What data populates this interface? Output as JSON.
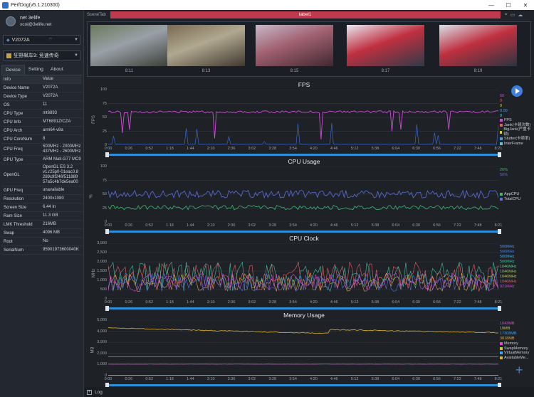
{
  "window": {
    "title": "PerfDog(v5.1.210300)"
  },
  "user": {
    "name": "net 3elife",
    "email": "xcoi@3elife.net"
  },
  "device_select": {
    "value": "V2072A"
  },
  "app_select": {
    "value": "狂野飙车9: 竞速传奇"
  },
  "tabs": [
    "Device",
    "Setting",
    "About"
  ],
  "device_table": {
    "headers": [
      "Info",
      "Value"
    ],
    "rows": [
      [
        "Device Name",
        "V2072A"
      ],
      [
        "Device Type",
        "V2072A"
      ],
      [
        "OS",
        "11"
      ],
      [
        "CPU Type",
        "mt6893"
      ],
      [
        "CPU Info",
        "MT6891Z/CZA"
      ],
      [
        "CPU Arch",
        "arm64-v8a"
      ],
      [
        "CPU CoreNum",
        "8"
      ],
      [
        "CPU Freq",
        "500MHz - 2000MHz 437MHz - 2600MHz"
      ],
      [
        "GPU Type",
        "ARM Mali-G77 MC9"
      ],
      [
        "OpenGL",
        "OpenGL ES 3.2 v1.r25p0-01eac0.8 289c9f246f511889 57a5c4b7de5ea00"
      ],
      [
        "GPU Freq",
        "unavailable"
      ],
      [
        "Resolution",
        "2400x1080"
      ],
      [
        "Screen Size",
        "6.44 In"
      ],
      [
        "Ram Size",
        "11.3 GB"
      ],
      [
        "LMK Threshold",
        "216MB"
      ],
      [
        "Swap",
        "4096 MB"
      ],
      [
        "Root",
        "No"
      ],
      [
        "SerialNum",
        "95901973600040K"
      ]
    ]
  },
  "scene": {
    "tab_label": "SceneTab",
    "label": "label1"
  },
  "screenshots": [
    {
      "time": "8:11",
      "colors": [
        "#6a7a5a",
        "#9aa0a8",
        "#3c4038"
      ]
    },
    {
      "time": "8:13",
      "colors": [
        "#7a6a50",
        "#b0a890",
        "#40382e"
      ]
    },
    {
      "time": "8:15",
      "colors": [
        "#c8b8c8",
        "#a06070",
        "#402830"
      ]
    },
    {
      "time": "8:17",
      "colors": [
        "#e8e8f0",
        "#c03040",
        "#303a48"
      ]
    },
    {
      "time": "8:19",
      "colors": [
        "#d8e0e8",
        "#c03040",
        "#2a3440"
      ]
    }
  ],
  "x_ticks": [
    "0:00",
    "0:26",
    "0:52",
    "1:18",
    "1:44",
    "2:10",
    "2:36",
    "3:02",
    "3:28",
    "3:54",
    "4:20",
    "4:46",
    "5:12",
    "5:38",
    "6:04",
    "6:30",
    "6:56",
    "7:22",
    "7:48",
    "8:21"
  ],
  "charts": [
    {
      "key": "fps",
      "title": "FPS",
      "ylabel": "FPS",
      "yticks": [
        "100",
        "75",
        "50",
        "25",
        "0"
      ],
      "ymax": 100,
      "legend": [
        {
          "name": "FPS",
          "color": "#d04ad8"
        },
        {
          "name": "Jank(卡顿次数)",
          "color": "#e06060"
        },
        {
          "name": "BigJank(严重卡顿)",
          "color": "#d0d040"
        },
        {
          "name": "Stutter(卡顿率)",
          "color": "#40a0e0"
        },
        {
          "name": "InterFrame",
          "color": "#60c0e0"
        }
      ],
      "values": [
        "60",
        "0",
        "0",
        "0.00",
        "0"
      ]
    },
    {
      "key": "cpu",
      "title": "CPU Usage",
      "ylabel": "%",
      "yticks": [
        "100",
        "75",
        "50",
        "25",
        "0"
      ],
      "ymax": 100,
      "legend": [
        {
          "name": "AppCPU",
          "color": "#3cb86a"
        },
        {
          "name": "TotalCPU",
          "color": "#5a6ee0"
        }
      ],
      "values": [
        "26%",
        "50%"
      ]
    },
    {
      "key": "clock",
      "title": "CPU Clock",
      "ylabel": "MHz",
      "yticks": [
        "3,000",
        "2,500",
        "2,000",
        "1,500",
        "1,000",
        "500",
        "0"
      ],
      "ymax": 3000,
      "legend": [],
      "values": [
        "500MHz",
        "500MHz",
        "500MHz",
        "500MHz",
        "1046MHz",
        "1046MHz",
        "1046MHz",
        "1046MHz",
        "921MHz"
      ]
    },
    {
      "key": "mem",
      "title": "Memory Usage",
      "ylabel": "MB",
      "yticks": [
        "5,000",
        "4,000",
        "3,000",
        "2,000",
        "1,000",
        "0"
      ],
      "ymax": 5000,
      "legend": [
        {
          "name": "Memory",
          "color": "#e04ad0"
        },
        {
          "name": "SwapMemory",
          "color": "#c8c840"
        },
        {
          "name": "VirtualMemory",
          "color": "#40a8e8"
        },
        {
          "name": "AvailableMe...",
          "color": "#e0b030"
        }
      ],
      "values": [
        "1043MB",
        "19MB",
        "17308MB",
        "3818MB"
      ]
    }
  ],
  "bottom": {
    "log_label": "Log"
  },
  "colors": {
    "accent": "#2e8fd8",
    "label_bar": "#c0394c"
  }
}
